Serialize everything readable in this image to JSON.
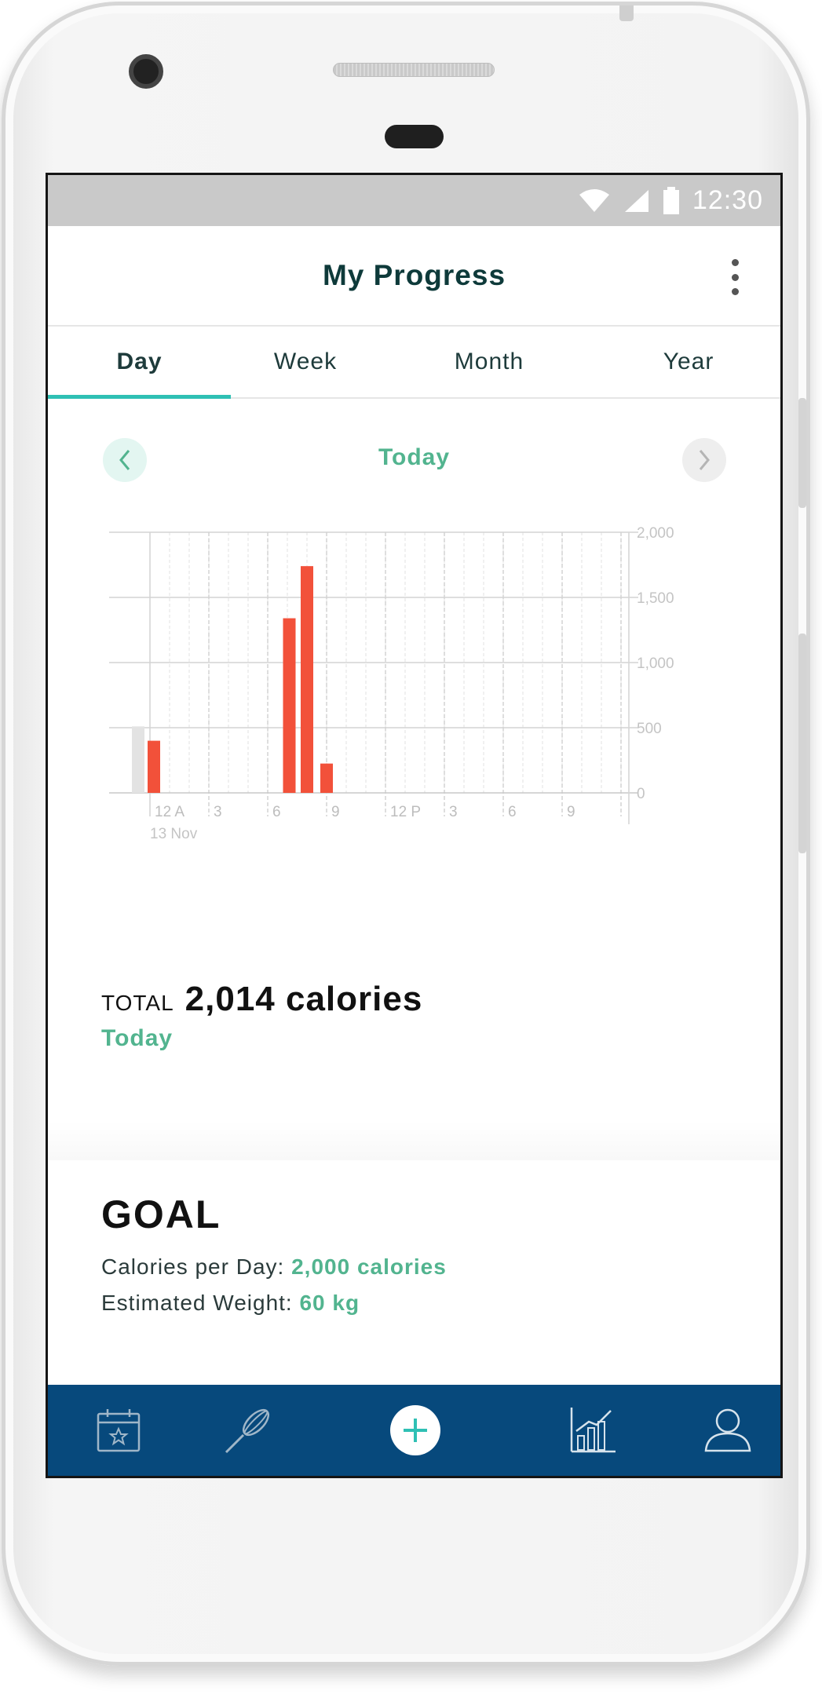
{
  "status_bar": {
    "time": "12:30",
    "icons": [
      "wifi-icon",
      "signal-icon",
      "battery-icon"
    ]
  },
  "header": {
    "title": "My Progress",
    "menu_icon": "more-vertical-icon"
  },
  "tabs": [
    {
      "label": "Day",
      "selected": true
    },
    {
      "label": "Week",
      "selected": false
    },
    {
      "label": "Month",
      "selected": false
    },
    {
      "label": "Year",
      "selected": false
    }
  ],
  "period_nav": {
    "label": "Today",
    "prev_icon": "chevron-left-icon",
    "next_icon": "chevron-right-icon"
  },
  "colors": {
    "accent": "#2fc0b4",
    "green_text": "#52b48f",
    "bar": "#f2513a",
    "nav_bg": "#07497c",
    "title": "#0e3a3a"
  },
  "chart_data": {
    "type": "bar",
    "x_ticks": [
      "12 A",
      "3",
      "6",
      "9",
      "12 P",
      "3",
      "6",
      "9"
    ],
    "x_sub_label": "13 Nov",
    "yticks": [
      "2,000",
      "1,500",
      "1,000",
      "500",
      "0"
    ],
    "ylim": [
      0,
      2000
    ],
    "grid": true,
    "y_axis_position": "right",
    "bars": [
      {
        "hour": 0.2,
        "value": 400
      },
      {
        "hour": 7.1,
        "value": 1340
      },
      {
        "hour": 8.0,
        "value": 1740
      },
      {
        "hour": 9.0,
        "value": 225
      }
    ],
    "previous_bar": {
      "hour": -0.6,
      "value": 510
    }
  },
  "total": {
    "label": "TOTAL",
    "value": "2,014 calories",
    "period": "Today"
  },
  "goal": {
    "title": "GOAL",
    "calories_label": "Calories per Day:",
    "calories_value": "2,000 calories",
    "weight_label": "Estimated Weight:",
    "weight_value": "60 kg"
  },
  "bottom_nav": [
    {
      "icon": "calendar-star-icon"
    },
    {
      "icon": "whisk-icon"
    },
    {
      "icon": "add-icon"
    },
    {
      "icon": "chart-icon"
    },
    {
      "icon": "profile-icon"
    }
  ]
}
